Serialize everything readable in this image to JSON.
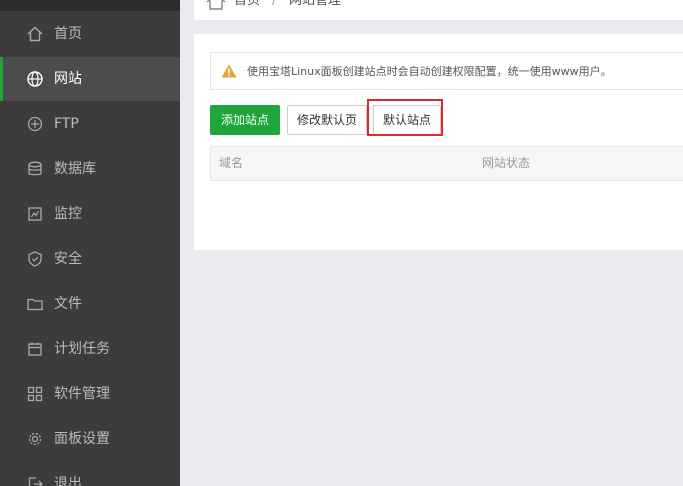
{
  "sidebar": {
    "items": [
      {
        "label": "首页",
        "icon": "home-icon",
        "active": false
      },
      {
        "label": "网站",
        "icon": "globe-icon",
        "active": true
      },
      {
        "label": "FTP",
        "icon": "ftp-icon",
        "active": false
      },
      {
        "label": "数据库",
        "icon": "database-icon",
        "active": false
      },
      {
        "label": "监控",
        "icon": "monitor-icon",
        "active": false
      },
      {
        "label": "安全",
        "icon": "shield-icon",
        "active": false
      },
      {
        "label": "文件",
        "icon": "folder-icon",
        "active": false
      },
      {
        "label": "计划任务",
        "icon": "calendar-icon",
        "active": false
      },
      {
        "label": "软件管理",
        "icon": "apps-grid-icon",
        "active": false
      },
      {
        "label": "面板设置",
        "icon": "gear-icon",
        "active": false
      },
      {
        "label": "退出",
        "icon": "logout-icon",
        "active": false
      }
    ]
  },
  "breadcrumb": {
    "home": "首页",
    "separator": "/",
    "current": "网站管理"
  },
  "notice": {
    "text": "使用宝塔Linux面板创建站点时会自动创建权限配置，统一使用www用户。",
    "icon": "warning-icon"
  },
  "toolbar": {
    "add_site": "添加站点",
    "edit_default_page": "修改默认页",
    "default_site": "默认站点"
  },
  "table": {
    "columns": [
      "域名",
      "网站状态"
    ]
  },
  "colors": {
    "sidebar_bg": "#3c3c3c",
    "accent_green": "#20a53a",
    "highlight_red": "#e0262e",
    "warning_orange": "#e6a23c"
  }
}
